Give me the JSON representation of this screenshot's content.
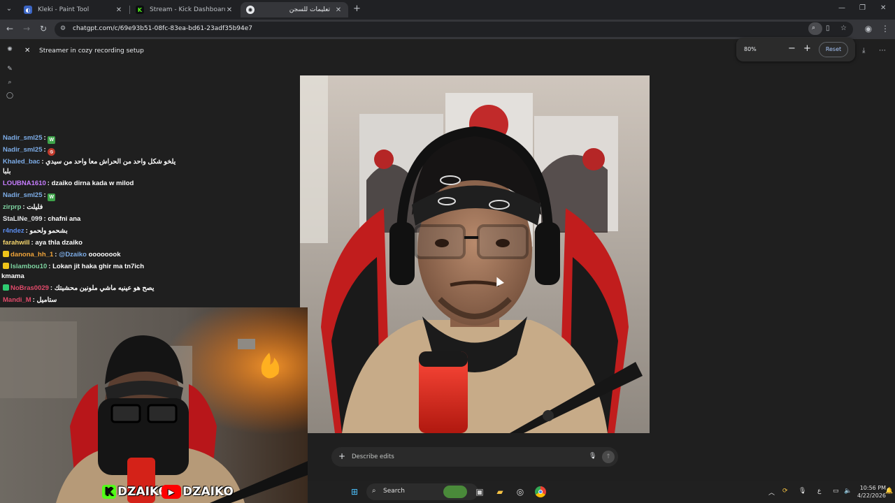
{
  "browser": {
    "tabs": [
      {
        "title": "Kleki - Paint Tool",
        "favicon_color": "#3c66c4",
        "active": false
      },
      {
        "title": "Stream - Kick Dashboard",
        "favicon_color": "#53fc18",
        "favicon_letter": "K",
        "active": false
      },
      {
        "title": "تعليمات للسجن",
        "active": true
      }
    ],
    "new_tab": "+",
    "url": "chatgpt.com/c/69e93b51-08fc-83ea-bd61-23adf35b94e7",
    "zoom_level": "80%",
    "zoom_reset_label": "Reset"
  },
  "app": {
    "title": "Streamer in cozy recording setup",
    "edit_placeholder": "Describe edits"
  },
  "chat": {
    "messages": [
      {
        "user": "Nadir_sml25",
        "text": "",
        "user_color": "#7dade8",
        "emote": "W",
        "emote_color": "#3ea34a"
      },
      {
        "user": "Nadir_sml25",
        "text": "",
        "user_color": "#7dade8",
        "emote": "⦸",
        "emote_color": "#c0392b"
      },
      {
        "user": "Khaled_bac",
        "text": "يلخو شكل واحد من الحراش معا واحد من سيدي",
        "user_color": "#7dade8"
      },
      {
        "user": "",
        "text": "بلبا",
        "user_color": "#ffffff"
      },
      {
        "user": "LOUBNA1610",
        "text": "dzaiko dirna kada w milod",
        "user_color": "#c77dff"
      },
      {
        "user": "Nadir_sml25",
        "text": "",
        "user_color": "#7dade8",
        "emote": "W",
        "emote_color": "#3ea34a"
      },
      {
        "user": "zirprp",
        "text": "فليلت",
        "user_color": "#7dd3a0"
      },
      {
        "user": "StaLINe_099",
        "text": "chafni ana",
        "user_color": "#e8eaed"
      },
      {
        "user": "r4ndez",
        "text": "بشحمو ولحمو",
        "user_color": "#5b8def"
      },
      {
        "user": "farahwill",
        "text": "aya thla dzaiko",
        "user_color": "#f6d66d"
      },
      {
        "user": "danona_hh_1",
        "text": "oooooook",
        "mention": "@Dzaiko",
        "user_color": "#f0a43a"
      },
      {
        "user": "Islambou10",
        "text": "Lokan jit haka ghir ma tn7ich",
        "user_color": "#7dd3a0"
      },
      {
        "user": "",
        "text": "kmama",
        "user_color": "#ffffff"
      },
      {
        "user": "NoBras0029",
        "text": "يصح هو عينيه ماشي ملونين محشيتك",
        "user_color": "#e04a6a"
      },
      {
        "user": "Mandi_M",
        "text": "ستاميل",
        "user_color": "#e04a6a"
      }
    ]
  },
  "overlay": {
    "brand_kick": "DZAIKO",
    "brand_youtube": "DZAIKO"
  },
  "taskbar": {
    "search_label": "Search",
    "time": "10:56 PM",
    "date": "4/22/2026",
    "lang": "ع"
  },
  "colors": {
    "kick_green": "#53fc18",
    "youtube_red": "#ff0000",
    "accent_blue": "#a8c7fa"
  }
}
